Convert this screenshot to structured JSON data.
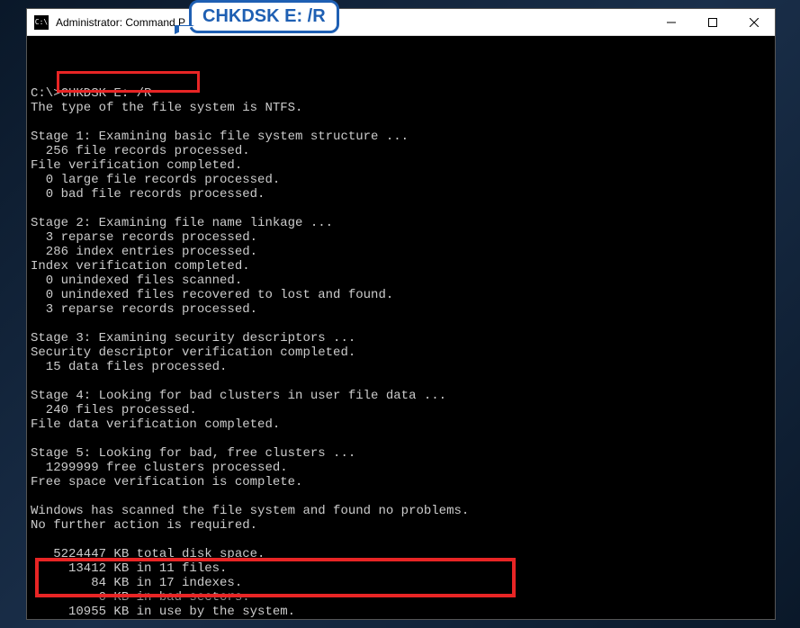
{
  "callout": {
    "text": "CHKDSK E: /R"
  },
  "window": {
    "title": "Administrator: Command P"
  },
  "terminal": {
    "lines": [
      "",
      "C:\\>CHKDSK E: /R",
      "The type of the file system is NTFS.",
      "",
      "Stage 1: Examining basic file system structure ...",
      "  256 file records processed.",
      "File verification completed.",
      "  0 large file records processed.",
      "  0 bad file records processed.",
      "",
      "Stage 2: Examining file name linkage ...",
      "  3 reparse records processed.",
      "  286 index entries processed.",
      "Index verification completed.",
      "  0 unindexed files scanned.",
      "  0 unindexed files recovered to lost and found.",
      "  3 reparse records processed.",
      "",
      "Stage 3: Examining security descriptors ...",
      "Security descriptor verification completed.",
      "  15 data files processed.",
      "",
      "Stage 4: Looking for bad clusters in user file data ...",
      "  240 files processed.",
      "File data verification completed.",
      "",
      "Stage 5: Looking for bad, free clusters ...",
      "  1299999 free clusters processed.",
      "Free space verification is complete.",
      "",
      "Windows has scanned the file system and found no problems.",
      "No further action is required.",
      "",
      "   5224447 KB total disk space.",
      "     13412 KB in 11 files.",
      "        84 KB in 17 indexes.",
      "         0 KB in bad sectors.",
      "     10955 KB in use by the system."
    ]
  }
}
